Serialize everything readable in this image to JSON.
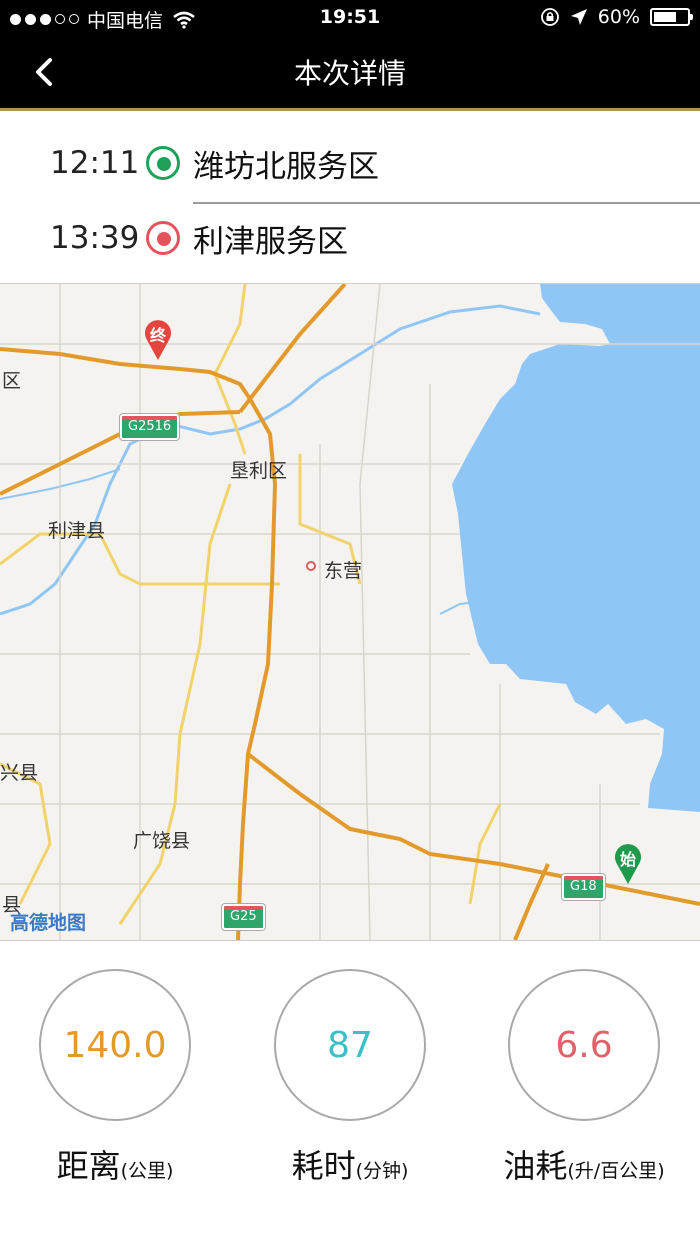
{
  "status_bar": {
    "carrier": "中国电信",
    "time": "19:51",
    "battery": "60%"
  },
  "nav": {
    "title": "本次详情"
  },
  "route": {
    "start": {
      "time": "12:11",
      "name": "潍坊北服务区"
    },
    "end": {
      "time": "13:39",
      "name": "利津服务区"
    }
  },
  "map": {
    "labels": {
      "qu": "区",
      "kenli": "垦利区",
      "lijin": "利津县",
      "dongying": "东营",
      "xingxian": "兴县",
      "guangrao": "广饶县",
      "xian": "县"
    },
    "shields": {
      "g2516": "G2516",
      "g18": "G18",
      "g25": "G25"
    },
    "pins": {
      "end": "终",
      "start": "始"
    },
    "logo": "高德地图"
  },
  "stats": {
    "distance": {
      "value": "140.0",
      "label": "距离",
      "unit": "(公里)",
      "color": "#e39a2b"
    },
    "duration": {
      "value": "87",
      "label": "耗时",
      "unit": "(分钟)",
      "color": "#3cbfc6"
    },
    "fuel": {
      "value": "6.6",
      "label": "油耗",
      "unit": "(升/百公里)",
      "color": "#e0616a"
    }
  }
}
